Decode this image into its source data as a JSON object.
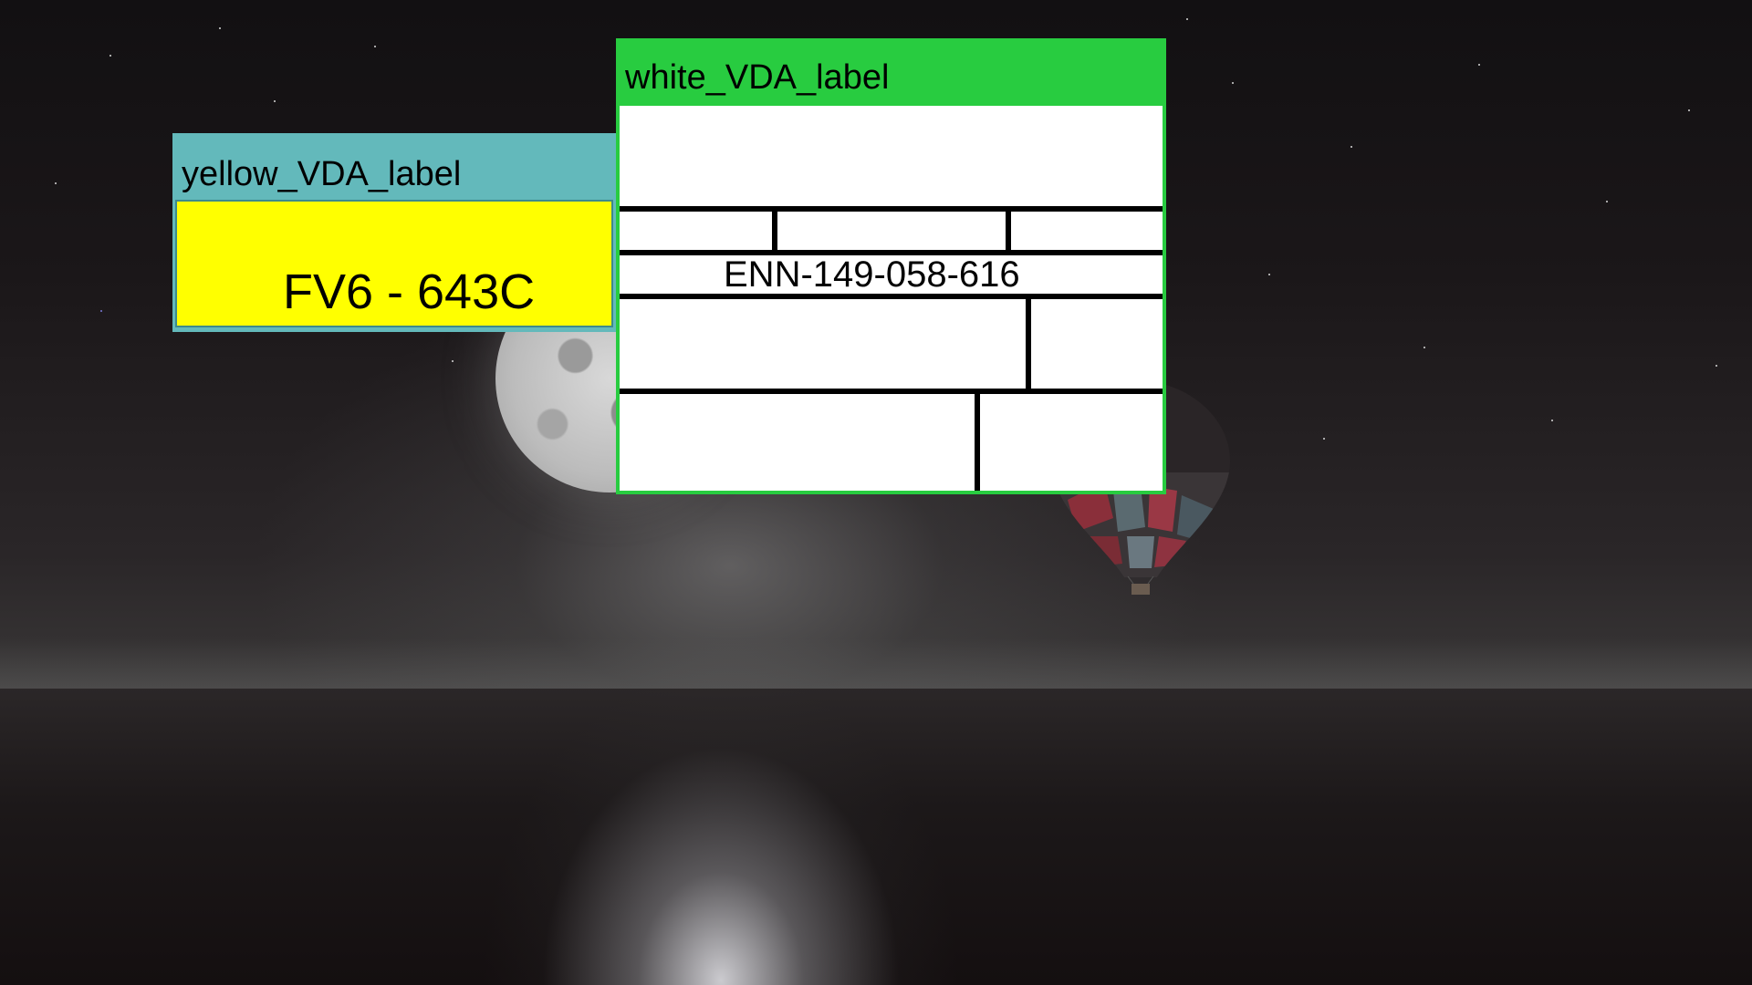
{
  "background": {
    "description_colors": {
      "sky": "#1b1719",
      "sea_reflection": "#e8e8ec",
      "moon": "#c8c8c8"
    }
  },
  "yellow_label": {
    "title": "yellow_VDA_label",
    "plate": "FV6 - 643C",
    "frame_color": "#63b9bb",
    "fill_color": "#ffff00"
  },
  "white_label": {
    "title": "white_VDA_label",
    "id_number": "ENN-149-058-616",
    "frame_color": "#28cc40",
    "fill_color": "#ffffff"
  }
}
